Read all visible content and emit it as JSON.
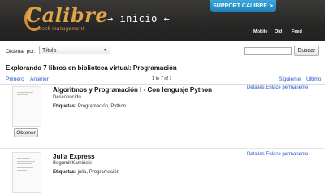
{
  "header": {
    "logo_text": "Calibre",
    "logo_subtitle": "ebook management",
    "page_title": "→ inicio ←",
    "support_label": "SUPPORT CALIBRE ➤",
    "nav": [
      "Mobile",
      "Old",
      "Feed"
    ]
  },
  "toolbar": {
    "sort_label": "Ordenar por:",
    "sort_value": "Título",
    "search_value": "",
    "search_button": "Buscar"
  },
  "library_heading": "Explorando 7 libros en biblioteca virtual: Programación",
  "pager": {
    "first": "Primero",
    "previous": "Anterior",
    "count": "1 to 7 of 7",
    "next": "Siguiente",
    "last": "Último"
  },
  "books": [
    {
      "title": "Algoritmos y Programación I - Con lenguaje Python",
      "author": "Desconocido",
      "tags_label": "Etiquetas:",
      "tags": "Programación, Python",
      "details_link": "Detalles",
      "permalink": "Enlace permanente",
      "get_button": "Obtener"
    },
    {
      "title": "Julia Express",
      "author": "Bogumił Kamiński",
      "tags_label": "Etiquetas:",
      "tags": "julia, Programación",
      "details_link": "Detalles",
      "permalink": "Enlace permanente"
    }
  ],
  "colors": {
    "header_bg": "#282726",
    "link": "#2255cc",
    "support_bg": "#2a93cc",
    "logo": "#e0a548"
  }
}
